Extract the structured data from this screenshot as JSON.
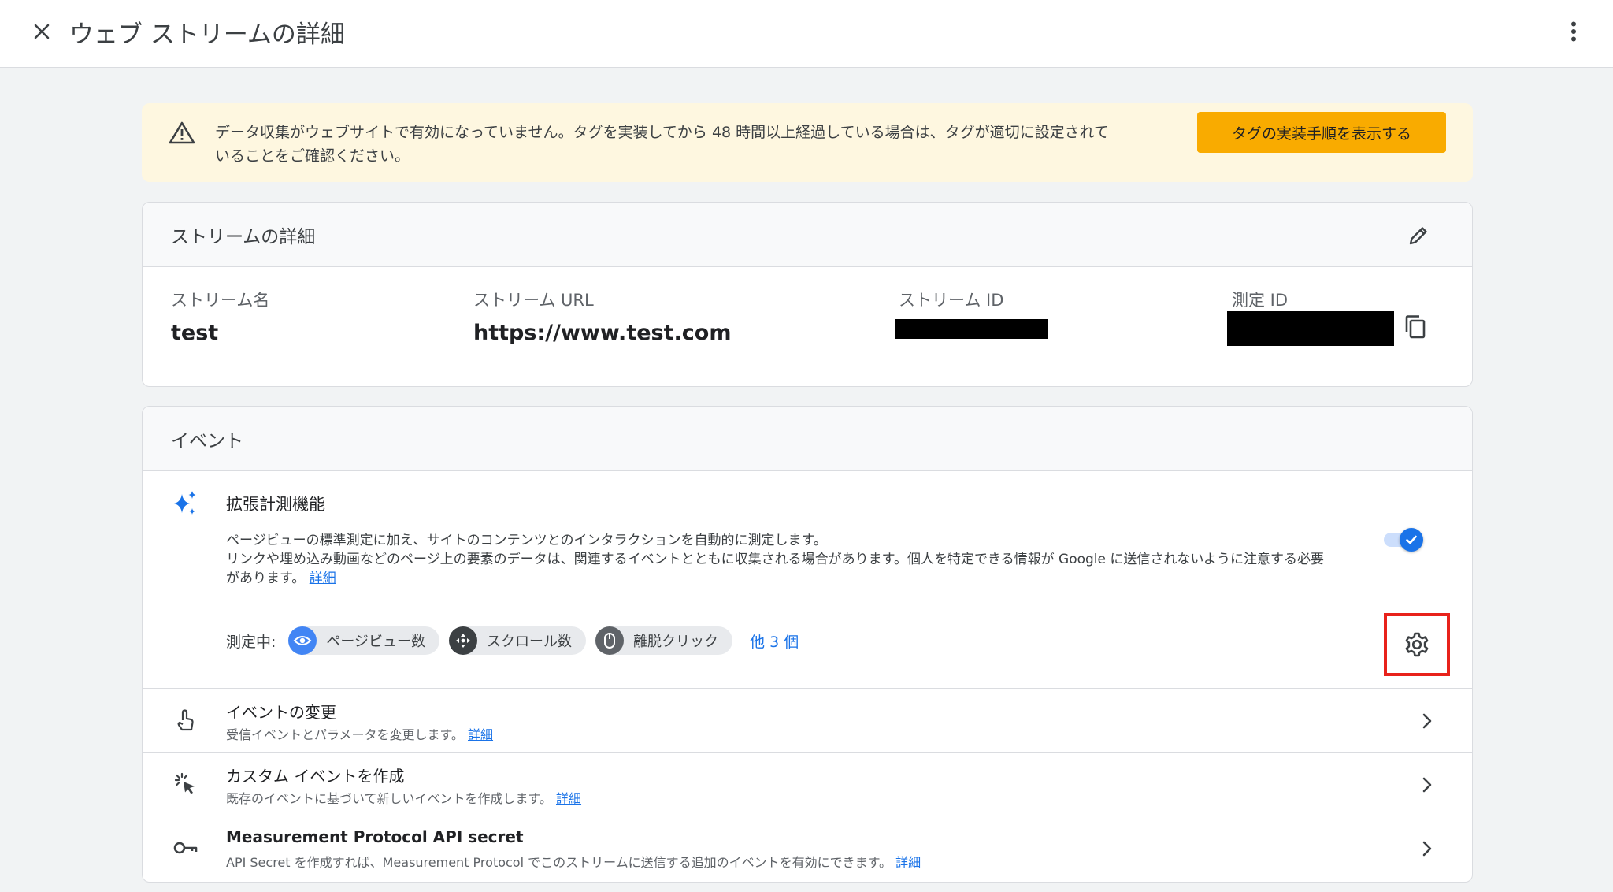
{
  "header": {
    "title": "ウェブ ストリームの詳細"
  },
  "banner": {
    "message_line1": "データ収集がウェブサイトで有効になっていません。タグを実装してから 48 時間以上経過している場合は、タグが適切に設定されて",
    "message_line2": "いることをご確認ください。",
    "button_label": "タグの実装手順を表示する"
  },
  "stream_details": {
    "heading": "ストリームの詳細",
    "name_label": "ストリーム名",
    "name_value": "test",
    "url_label": "ストリーム URL",
    "url_value": "https://www.test.com",
    "id_label": "ストリーム ID",
    "measurement_id_label": "測定 ID"
  },
  "events": {
    "heading": "イベント",
    "enhanced": {
      "title": "拡張計測機能",
      "desc_line1": "ページビューの標準測定に加え、サイトのコンテンツとのインタラクションを自動的に測定します。",
      "desc_line2": "リンクや埋め込み動画などのページ上の要素のデータは、関連するイベントとともに収集される場合があります。個人を特定できる情報が Google に送信されないように注意する必要",
      "desc_line3": "があります。",
      "link": "詳細",
      "toggle_on": true,
      "measuring_label": "測定中:",
      "chips": [
        "ページビュー数",
        "スクロール数",
        "離脱クリック"
      ],
      "more": "他 3 個"
    },
    "rows": [
      {
        "title": "イベントの変更",
        "subtitle": "受信イベントとパラメータを変更します。",
        "link": "詳細"
      },
      {
        "title": "カスタム イベントを作成",
        "subtitle": "既存のイベントに基づいて新しいイベントを作成します。",
        "link": "詳細"
      },
      {
        "title": "Measurement Protocol API secret",
        "subtitle": "API Secret を作成すれば、Measurement Protocol でこのストリームに送信する追加のイベントを有効にできます。",
        "link": "詳細"
      }
    ]
  },
  "colors": {
    "accent": "#1a73e8",
    "warning_bg": "#fef7e0",
    "warning_button": "#f9ab00",
    "highlight_box": "#e8221b"
  }
}
